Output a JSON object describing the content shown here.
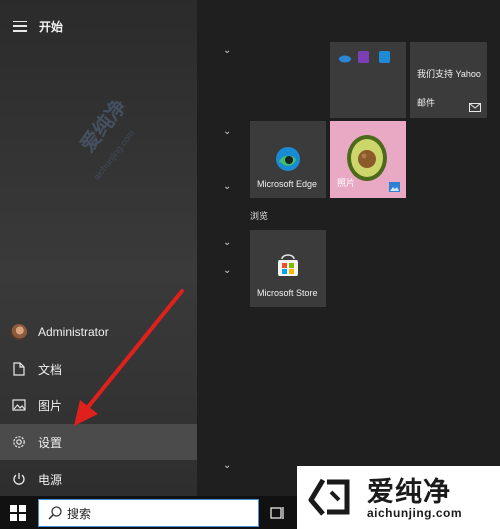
{
  "start_menu": {
    "title": "开始",
    "user": "Administrator",
    "documents": "文档",
    "pictures": "图片",
    "settings": "设置",
    "power": "电源"
  },
  "tiles": {
    "yahoo_line": "我们支持 Yahoo",
    "mail": "邮件",
    "edge": "Microsoft Edge",
    "photos": "照片",
    "browse_group": "浏览",
    "store": "Microsoft Store"
  },
  "taskbar": {
    "search_placeholder": "搜索"
  },
  "watermark": {
    "brand": "爱纯净",
    "url": "aichunjing.com"
  },
  "colors": {
    "accent_arrow": "#e0201c",
    "search_border": "#4a90d9"
  }
}
